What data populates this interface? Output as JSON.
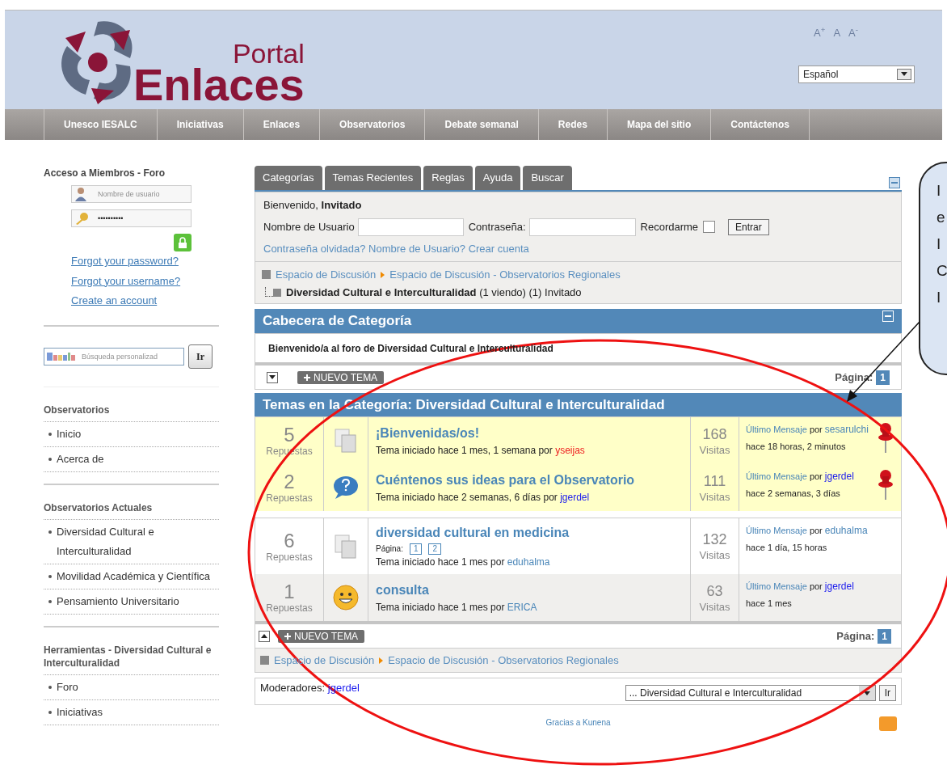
{
  "header": {
    "logo": {
      "small": "Portal",
      "big": "Enlaces"
    },
    "font_size_controls": [
      "A$^{+}$",
      "A",
      "A$^{-}$"
    ],
    "language": "Español"
  },
  "nav": [
    "Unesco IESALC",
    "Iniciativas",
    "Enlaces",
    "Observatorios",
    "Debate semanal",
    "Redes",
    "Mapa del sitio",
    "Contáctenos"
  ],
  "sidebar": {
    "login": {
      "title": "Acceso a Miembros - Foro",
      "username_placeholder": "Nombre de usuario",
      "password": "••••••••••",
      "links": [
        "Forgot your password?",
        "Forgot your username?",
        "Create an account"
      ]
    },
    "search": {
      "placeholder": "Búsqueda personalizad",
      "button": "Ir"
    },
    "sections": [
      {
        "title": "Observatorios",
        "items": [
          "Inicio",
          "Acerca de"
        ]
      },
      {
        "title": "Observatorios Actuales",
        "items": [
          "Diversidad Cultural e Interculturalidad",
          "Movilidad Académica y Científica",
          "Pensamiento Universitario"
        ]
      },
      {
        "title": "Herramientas - Diversidad Cultural e Interculturalidad",
        "items": [
          "Foro",
          "Iniciativas"
        ]
      }
    ]
  },
  "forum": {
    "tabs": [
      {
        "label": "Categorías",
        "selected": false
      },
      {
        "label": "Temas Recientes",
        "selected": false
      },
      {
        "label": "Reglas",
        "selected": false
      },
      {
        "label": "Ayuda",
        "selected": false
      },
      {
        "label": "Buscar",
        "selected": false
      }
    ],
    "welcome": {
      "prefix": "Bienvenido,",
      "user": "Invitado"
    },
    "login": {
      "user_label": "Nombre de Usuario",
      "pass_label": "Contraseña:",
      "remember_label": "Recordarme",
      "remember": false,
      "button": "Entrar",
      "links": "Contraseña olvidada? Nombre de Usuario? Crear cuenta"
    },
    "breadcrumb": [
      "Espacio de Discusión",
      "Espacio de Discusión - Observatorios Regionales"
    ],
    "current": {
      "name": "Diversidad Cultural e Interculturalidad",
      "info": "(1 viendo) (1) Invitado"
    },
    "header_title": "Cabecera de Categoría",
    "header_text": "Bienvenido/a al foro de Diversidad Cultural e Interculturalidad",
    "top_bar": {
      "new_topic": "NUEVO TEMA",
      "page_label": "Página:",
      "page": "1"
    },
    "topics_title": "Temas en la Categoría: Diversidad Cultural e Interculturalidad",
    "topics": [
      {
        "replies": "5",
        "replies_label": "Repuestas",
        "kind": "document",
        "title": "¡Bienvenidas/os!",
        "started": "Tema iniciado hace 1 mes, 1 semana por",
        "author": {
          "name": "yseijas",
          "color": "#ee2222"
        },
        "views": "168",
        "views_label": "Visitas",
        "last_label": "Último Mensaje",
        "last_by": "por",
        "last_user": {
          "name": "sesarulchi",
          "color": "#4a86b8"
        },
        "last_time": "hace 18 horas, 2 minutos",
        "pinned": true
      },
      {
        "replies": "2",
        "replies_label": "Repuestas",
        "kind": "question",
        "title": "Cuéntenos sus ideas para el Observatorio",
        "started": "Tema iniciado hace 2 semanas, 6 días por",
        "author": {
          "name": "jgerdel",
          "color": "#1a1aee"
        },
        "views": "111",
        "views_label": "Visitas",
        "last_label": "Último Mensaje",
        "last_by": "por",
        "last_user": {
          "name": "jgerdel",
          "color": "#1a1aee"
        },
        "last_time": "hace 2 semanas, 3 días",
        "pinned": true
      },
      {
        "replies": "6",
        "replies_label": "Repuestas",
        "kind": "document",
        "title": "diversidad cultural en medicina",
        "pages_label": "Página:",
        "pages": [
          "1",
          "2"
        ],
        "started": "Tema iniciado hace 1 mes por",
        "author": {
          "name": "eduhalma",
          "color": "#4a86b8"
        },
        "views": "132",
        "views_label": "Visitas",
        "last_label": "Último Mensaje",
        "last_by": "por",
        "last_user": {
          "name": "eduhalma",
          "color": "#4a86b8"
        },
        "last_time": "hace 1 día, 15 horas",
        "pinned": false
      },
      {
        "replies": "1",
        "replies_label": "Repuestas",
        "kind": "smiley",
        "title": "consulta",
        "started": "Tema iniciado hace 1 mes por",
        "author": {
          "name": "ERICA",
          "color": "#4a86b8"
        },
        "views": "63",
        "views_label": "Visitas",
        "last_label": "Último Mensaje",
        "last_by": "por",
        "last_user": {
          "name": "jgerdel",
          "color": "#1a1aee"
        },
        "last_time": "hace 1 mes",
        "pinned": false
      }
    ],
    "bottom_bar": {
      "new_topic": "NUEVO TEMA",
      "page_label": "Página:",
      "page": "1"
    },
    "bottom_breadcrumb": [
      "Espacio de Discusión",
      "Espacio de Discusión - Observatorios Regionales"
    ],
    "moderators_label": "Moderadores:",
    "moderator": "jgerdel",
    "jump": "... Diversidad Cultural e Interculturalidad",
    "jump_button": "Ir",
    "footer": "Gracias a Kunena"
  },
  "callout": {
    "lines": [
      "I",
      "e",
      "I",
      "C",
      "I"
    ]
  }
}
